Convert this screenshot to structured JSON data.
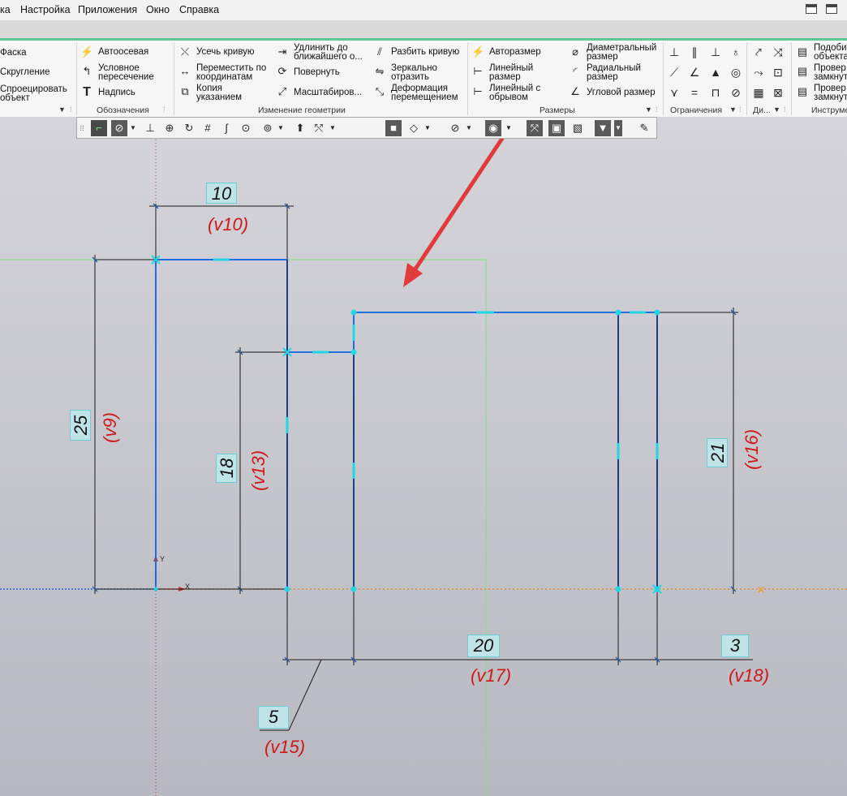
{
  "menubar": {
    "items": [
      "ка",
      "Настройка",
      "Приложения",
      "Окно",
      "Справка"
    ]
  },
  "ribbon": {
    "col1": [
      "Фаска",
      "Скругление",
      "Спроецировать",
      "объект"
    ],
    "oboznacheniya": {
      "label": "Обозначения",
      "items": [
        "Автоосевая",
        "Условное",
        "пересечение",
        "Надпись"
      ]
    },
    "geometry": {
      "label": "Изменение геометрии",
      "items": [
        "Усечь кривую",
        "Переместить по",
        "координатам",
        "Копия",
        "указанием",
        "Удлинить до",
        "ближайшего о...",
        "Повернуть",
        "Масштабиров...",
        "Разбить кривую",
        "Зеркально",
        "отразить",
        "Деформация",
        "перемещением"
      ]
    },
    "razmery": {
      "label": "Размеры",
      "items": [
        "Авторазмер",
        "Линейный",
        "размер",
        "Линейный с",
        "обрывом",
        "Диаметральный",
        "размер",
        "Радиальный",
        "размер",
        "Угловой размер"
      ]
    },
    "ogranicheniya": {
      "label": "Ограничения"
    },
    "di": {
      "label": "Ди..."
    },
    "instrum": {
      "label": "Инструме",
      "items": [
        "Подоби",
        "объекта",
        "Провер",
        "замкнут",
        "Провер",
        "замкнут"
      ]
    }
  },
  "drawing": {
    "axis_y": "Y",
    "axis_x": "X",
    "dims": {
      "d10": {
        "value": "10",
        "var": "(v10)"
      },
      "d25": {
        "value": "25",
        "var": "(v9)"
      },
      "d18": {
        "value": "18",
        "var": "(v13)"
      },
      "d21": {
        "value": "21",
        "var": "(v16)"
      },
      "d20": {
        "value": "20",
        "var": "(v17)"
      },
      "d3": {
        "value": "3",
        "var": "(v18)"
      },
      "d5": {
        "value": "5",
        "var": "(v15)"
      }
    }
  },
  "colors": {
    "sketch_line": "#1f6fe0",
    "dimension_line": "#1a1a1a",
    "variable_text": "#d11818",
    "frame_green": "#7fe07f",
    "annotation_arrow": "#e23b3b",
    "ribbon_accent": "#5fc893"
  }
}
